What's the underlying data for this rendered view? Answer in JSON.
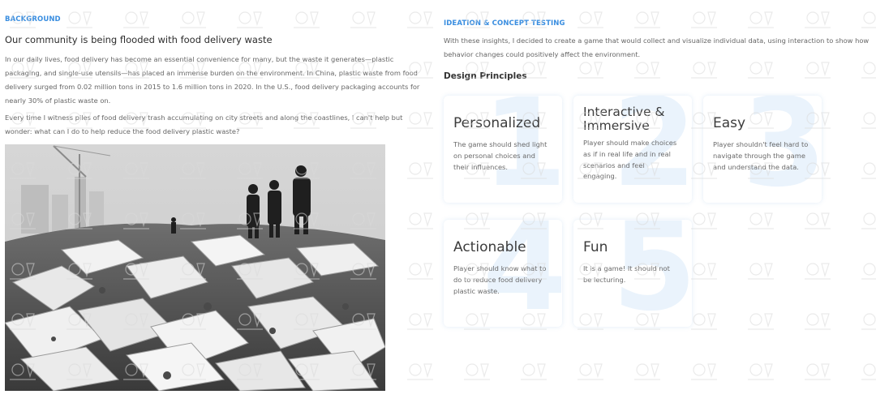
{
  "background": {
    "label": "BACKGROUND",
    "heading": "Our community is being flooded with food delivery waste",
    "paragraph1": "In our daily lives, food delivery has become an essential convenience for many, but the waste it generates—plastic packaging, and single-use utensils—has placed an immense burden on the environment. In China, plastic waste from food delivery surged from 0.02 million tons in 2015 to 1.6 million tons in 2020. In the U.S., food delivery packaging accounts for nearly 30% of plastic waste on.",
    "paragraph2": "Every time I witness piles of food delivery trash accumulating on city streets and along the coastlines, I can't help but wonder: what can I do to help reduce the food delivery plastic waste?",
    "photo_icon": "waste-photo"
  },
  "ideation": {
    "label": "IDEATION & CONCEPT TESTING",
    "paragraph": "With these insights, I decided to create a game that would collect and visualize individual data, using interaction to show how behavior changes could positively affect the environment.",
    "principles_heading": "Design Principles",
    "principles": [
      {
        "number": "1",
        "title": "Personalized",
        "desc": "The game should shed light on personal choices and their influences."
      },
      {
        "number": "2",
        "title": "Interactive & Immersive",
        "desc": "Player should make choices as if in real life and in real scenarios and feel engaging."
      },
      {
        "number": "3",
        "title": "Easy",
        "desc": "Player shouldn't feel hard to navigate through the game and understand the data."
      },
      {
        "number": "4",
        "title": "Actionable",
        "desc": "Player should know what to do to reduce food delivery plastic waste."
      },
      {
        "number": "5",
        "title": "Fun",
        "desc": "It is a game! It should not be lecturing."
      }
    ]
  },
  "colors": {
    "accent": "#3a8ee0",
    "number_tint": "#eaf3fc"
  }
}
